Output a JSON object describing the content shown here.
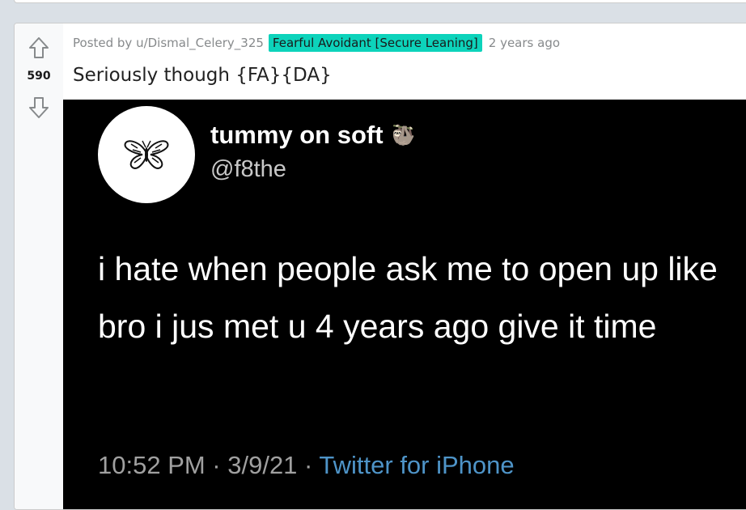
{
  "post": {
    "score": "590",
    "posted_by": "Posted by u/Dismal_Celery_325",
    "flair": "Fearful Avoidant [Secure Leaning]",
    "time_ago": "2 years ago",
    "title": "Seriously though {FA}{DA}",
    "colors": {
      "flair_bg": "#0dd3bb",
      "vote_column_bg": "#f8f9fa",
      "page_bg": "#dae0e6"
    },
    "icons": {
      "upvote": "arrow-up-outline-icon",
      "downvote": "arrow-down-outline-icon"
    }
  },
  "tweet": {
    "display_name": "tummy on soft",
    "handle": "@f8the",
    "text": "i hate when people ask me to open up like bro i jus met u 4 years ago give it time",
    "timestamp": "10:52 PM · 3/9/21 · ",
    "source": "Twitter for iPhone",
    "avatar_icon": "butterfly-icon",
    "name_emoji": "sloth-emoji-icon"
  }
}
